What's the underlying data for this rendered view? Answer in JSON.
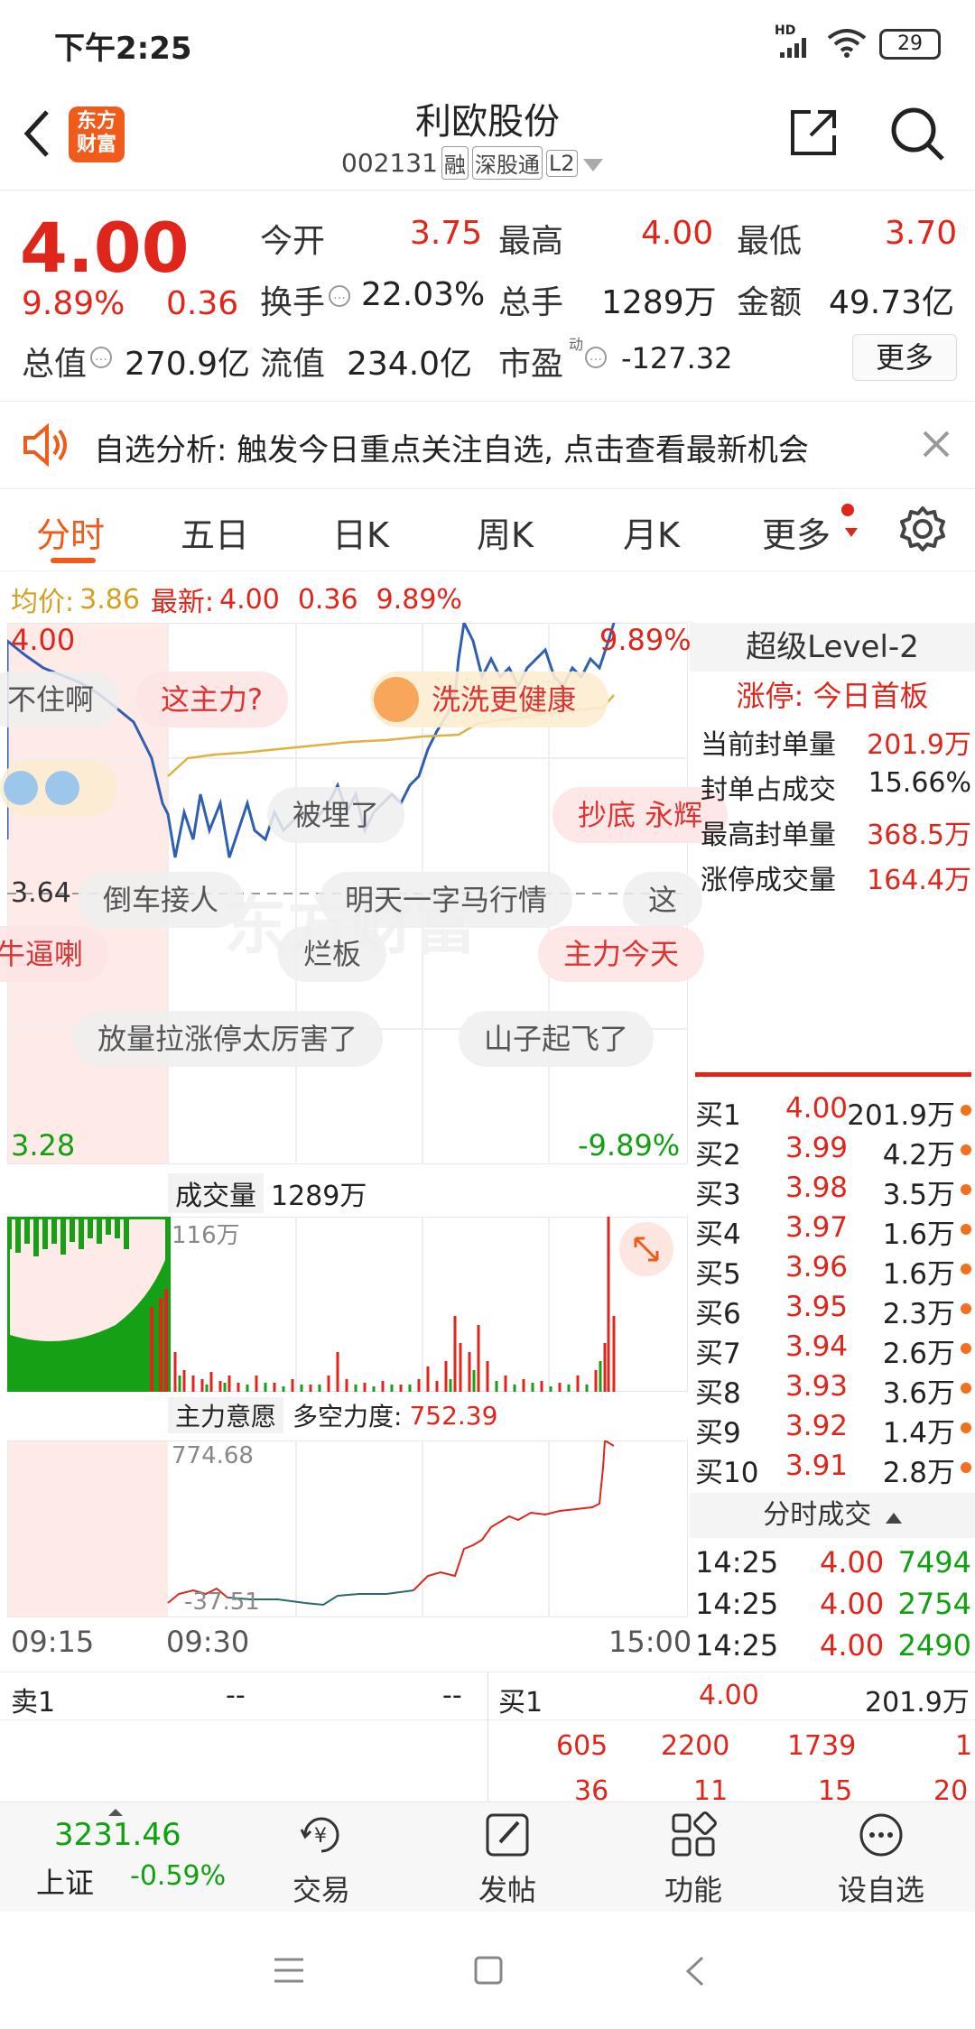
{
  "status_bar": {
    "time": "下午2:25",
    "battery": "29",
    "network": "HD"
  },
  "header": {
    "logo_line1": "东方",
    "logo_line2": "财富",
    "title": "利欧股份",
    "code": "002131",
    "tag_margin": "融",
    "tag_connect": "深股通",
    "tag_level": "L2"
  },
  "quote": {
    "price": "4.00",
    "change_pct": "9.89%",
    "change": "0.36",
    "open_label": "今开",
    "open": "3.75",
    "high_label": "最高",
    "high": "4.00",
    "low_label": "最低",
    "low": "3.70",
    "turnover_label": "换手",
    "turnover": "22.03%",
    "volume_label": "总手",
    "volume": "1289万",
    "amount_label": "金额",
    "amount": "49.73亿",
    "mktcap_label": "总值",
    "mktcap": "270.9亿",
    "float_label": "流值",
    "float": "234.0亿",
    "pe_label": "市盈",
    "pe_sup": "动",
    "pe": "-127.32",
    "more_button": "更多"
  },
  "banner": {
    "text": "自选分析: 触发今日重点关注自选, 点击查看最新机会"
  },
  "tabs": [
    "分时",
    "五日",
    "日K",
    "周K",
    "月K",
    "更多"
  ],
  "chart": {
    "avg_label": "均价:",
    "avg": "3.86",
    "latest_label": "最新:",
    "latest": "4.00",
    "latest_change": "0.36",
    "latest_pct": "9.89%",
    "top_left": "4.00",
    "top_right": "9.89%",
    "mid_left": "3.64",
    "bottom_left": "3.28",
    "bottom_right": "-9.89%",
    "volume_selector": "成交量",
    "volume_total": "1289万",
    "volume_max": "116万",
    "indicator_selector": "主力意愿",
    "indicator_label": "多空力度:",
    "indicator_value": "752.39",
    "indicator_max": "774.68",
    "indicator_min": "-37.51",
    "time_start": "09:15",
    "time_open": "09:30",
    "time_end": "15:00",
    "line_color": "#2f5fb0",
    "avg_color": "#e0b040"
  },
  "bubbles": [
    {
      "text": "不住啊",
      "pink": false
    },
    {
      "text": "这主力?",
      "pink": true
    },
    {
      "text": "洗洗更健康",
      "pink": true
    },
    {
      "text": "被埋了",
      "pink": false
    },
    {
      "text": "抄底 永辉",
      "pink": true
    },
    {
      "text": "倒车接人",
      "pink": false
    },
    {
      "text": "明天一字马行情",
      "pink": false
    },
    {
      "text": "这",
      "pink": false
    },
    {
      "text": "牛逼喇",
      "pink": true
    },
    {
      "text": "烂板",
      "pink": false
    },
    {
      "text": "主力今天",
      "pink": true
    },
    {
      "text": "放量拉涨停太厉害了",
      "pink": false
    },
    {
      "text": "山子起飞了",
      "pink": false
    }
  ],
  "level2": {
    "title": "超级Level-2",
    "status": "涨停: 今日首板",
    "rows": [
      {
        "label": "当前封单量",
        "value": "201.9万"
      },
      {
        "label": "封单占成交",
        "value": "15.66%"
      },
      {
        "label": "最高封单量",
        "value": "368.5万"
      },
      {
        "label": "涨停成交量",
        "value": "164.4万"
      }
    ]
  },
  "order_book": [
    {
      "name": "买1",
      "price": "4.00",
      "vol": "201.9万"
    },
    {
      "name": "买2",
      "price": "3.99",
      "vol": "4.2万"
    },
    {
      "name": "买3",
      "price": "3.98",
      "vol": "3.5万"
    },
    {
      "name": "买4",
      "price": "3.97",
      "vol": "1.6万"
    },
    {
      "name": "买5",
      "price": "3.96",
      "vol": "1.6万"
    },
    {
      "name": "买6",
      "price": "3.95",
      "vol": "2.3万"
    },
    {
      "name": "买7",
      "price": "3.94",
      "vol": "2.6万"
    },
    {
      "name": "买8",
      "price": "3.93",
      "vol": "3.6万"
    },
    {
      "name": "买9",
      "price": "3.92",
      "vol": "1.4万"
    },
    {
      "name": "买10",
      "price": "3.91",
      "vol": "2.8万"
    }
  ],
  "trades": {
    "title": "分时成交",
    "rows": [
      {
        "time": "14:25",
        "price": "4.00",
        "vol": "7494"
      },
      {
        "time": "14:25",
        "price": "4.00",
        "vol": "2754"
      },
      {
        "time": "14:25",
        "price": "4.00",
        "vol": "2490"
      }
    ]
  },
  "bottom_panel": {
    "sell1_label": "卖1",
    "sell1_price": "--",
    "sell1_vol": "--",
    "buy1_label": "买1",
    "buy1_price": "4.00",
    "buy1_vol": "201.9万",
    "queue_row1": [
      "605",
      "2200",
      "1739",
      "1"
    ],
    "queue_row2": [
      "36",
      "11",
      "15",
      "20"
    ]
  },
  "bottom_nav": {
    "index_value": "3231.46",
    "index_name": "上证",
    "index_change": "-0.59%",
    "items": [
      "交易",
      "发帖",
      "功能",
      "设自选"
    ]
  }
}
